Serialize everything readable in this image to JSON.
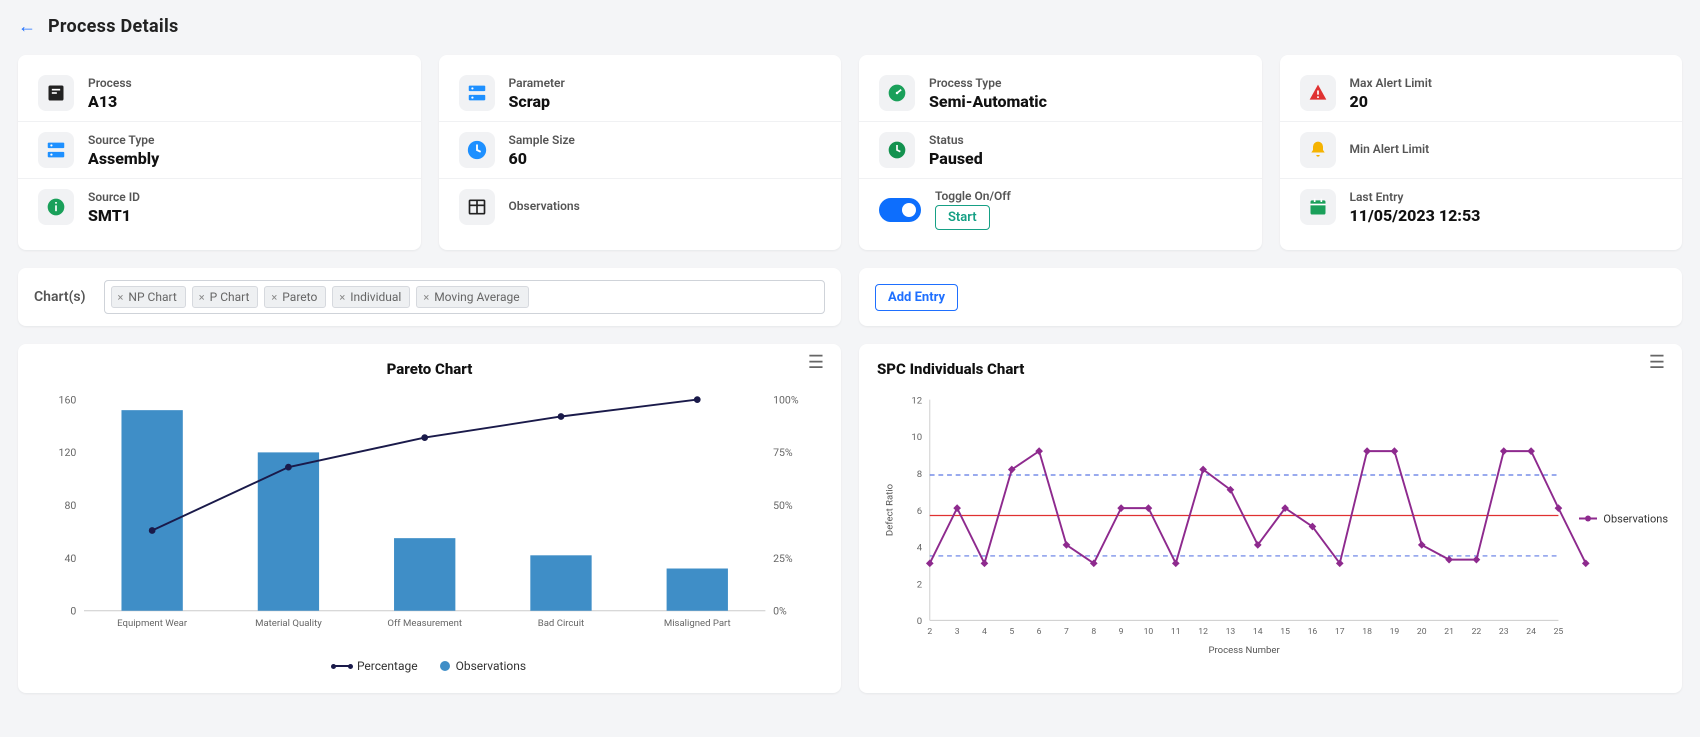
{
  "header": {
    "title": "Process Details"
  },
  "cards": {
    "col1": {
      "process_label": "Process",
      "process_value": "A13",
      "source_type_label": "Source Type",
      "source_type_value": "Assembly",
      "source_id_label": "Source ID",
      "source_id_value": "SMT1"
    },
    "col2": {
      "parameter_label": "Parameter",
      "parameter_value": "Scrap",
      "sample_label": "Sample Size",
      "sample_value": "60",
      "obs_label": "Observations",
      "obs_value": ""
    },
    "col3": {
      "ptype_label": "Process Type",
      "ptype_value": "Semi-Automatic",
      "status_label": "Status",
      "status_value": "Paused",
      "toggle_label": "Toggle On/Off",
      "toggle_btn": "Start"
    },
    "col4": {
      "max_label": "Max Alert Limit",
      "max_value": "20",
      "min_label": "Min Alert Limit",
      "min_value": "",
      "last_label": "Last Entry",
      "last_value": "11/05/2023 12:53"
    }
  },
  "charts_selector": {
    "label": "Chart(s)",
    "tags": [
      "NP Chart",
      "P Chart",
      "Pareto",
      "Individual",
      "Moving Average"
    ]
  },
  "add_entry_label": "Add Entry",
  "pareto": {
    "title": "Pareto Chart",
    "legend": {
      "line": "Percentage",
      "bar": "Observations"
    }
  },
  "spc": {
    "title": "SPC Individuals Chart",
    "legend": "Observations"
  },
  "chart_data": [
    {
      "type": "bar",
      "title": "Pareto Chart",
      "categories": [
        "Equipment Wear",
        "Material Quality",
        "Off Measurement",
        "Bad Circuit",
        "Misaligned Part"
      ],
      "series": [
        {
          "name": "Observations",
          "values": [
            152,
            120,
            55,
            42,
            32
          ],
          "kind": "bar"
        },
        {
          "name": "Percentage",
          "values": [
            38,
            68,
            82,
            92,
            100
          ],
          "kind": "line"
        }
      ],
      "y_left": {
        "label": "",
        "ticks": [
          0,
          40,
          80,
          120,
          160
        ]
      },
      "y_right": {
        "label": "",
        "ticks": [
          "0%",
          "25%",
          "50%",
          "75%",
          "100%"
        ]
      },
      "xlabel": "",
      "ylabel": ""
    },
    {
      "type": "line",
      "title": "SPC Individuals Chart",
      "xlabel": "Process Number",
      "ylabel": "Defect Ratio",
      "x": [
        2,
        3,
        4,
        5,
        6,
        7,
        8,
        9,
        10,
        11,
        12,
        13,
        14,
        15,
        16,
        17,
        18,
        19,
        20,
        21,
        22,
        23,
        24,
        25
      ],
      "series": [
        {
          "name": "Observations",
          "values": [
            3.1,
            6.1,
            3.1,
            8.2,
            9.2,
            4.1,
            3.1,
            6.1,
            6.1,
            3.1,
            8.2,
            7.1,
            4.1,
            6.1,
            5.1,
            3.1,
            9.2,
            9.2,
            4.1,
            3.3,
            3.3,
            9.2,
            9.2,
            6.1,
            3.1
          ]
        }
      ],
      "ref_lines": {
        "centerline": 5.7,
        "ucl": 7.9,
        "lcl": 3.5
      },
      "ylim": [
        0,
        12
      ],
      "y_ticks": [
        0,
        2,
        4,
        6,
        8,
        10,
        12
      ]
    }
  ]
}
